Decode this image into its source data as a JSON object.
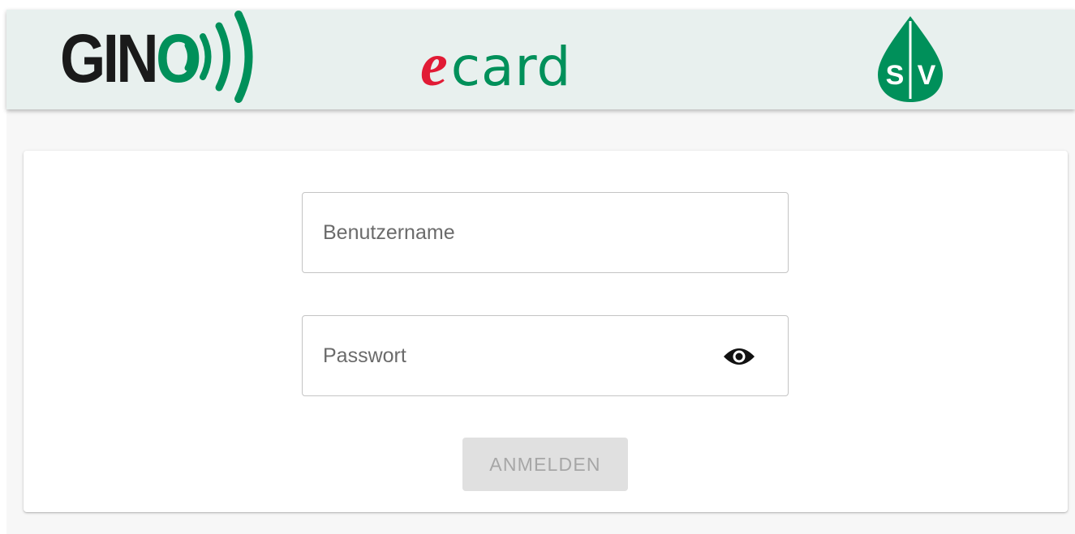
{
  "header": {
    "logo_gino": {
      "text": "GIN",
      "o_text": "O",
      "accent_color": "#00905a"
    },
    "logo_ecard": {
      "e_text": "e",
      "rest_text": "card",
      "e_color": "#e11b35",
      "card_color": "#00905a"
    },
    "logo_sv": {
      "text_s": "S",
      "text_v": "V",
      "color": "#00905a"
    },
    "background_color": "#e8f0ee"
  },
  "login_form": {
    "username": {
      "placeholder": "Benutzername",
      "value": ""
    },
    "password": {
      "placeholder": "Passwort",
      "value": "",
      "toggle_icon": "eye-icon"
    },
    "submit": {
      "label": "ANMELDEN",
      "state": "disabled"
    }
  }
}
